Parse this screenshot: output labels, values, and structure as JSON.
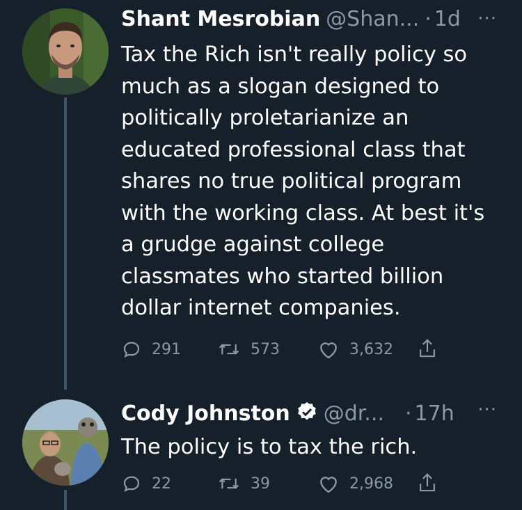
{
  "tweets": [
    {
      "name": "Shant Mesrobian",
      "handle": "@Shan...",
      "dot": "·",
      "time": "1d",
      "more": "···",
      "text": "Tax the Rich isn't really policy so much as a slogan designed to politically proletarianize an educated professional class that shares no true political program with the working class. At best it's a grudge against college classmates who started billion dollar internet companies.",
      "replies": "291",
      "retweets": "573",
      "likes": "3,632"
    },
    {
      "name": "Cody Johnston",
      "handle": "@dr...",
      "dot": "·",
      "time": "17h",
      "more": "···",
      "verified": true,
      "text": "The policy is to tax the rich.",
      "replies": "22",
      "retweets": "39",
      "likes": "2,968"
    }
  ],
  "icons": [
    "reply-icon",
    "retweet-icon",
    "like-icon",
    "share-icon",
    "verified-badge-icon"
  ],
  "colors": {
    "background": "#15202b",
    "text": "#ffffff",
    "secondary": "#8b98a5",
    "thread_line": "#3d5466"
  }
}
